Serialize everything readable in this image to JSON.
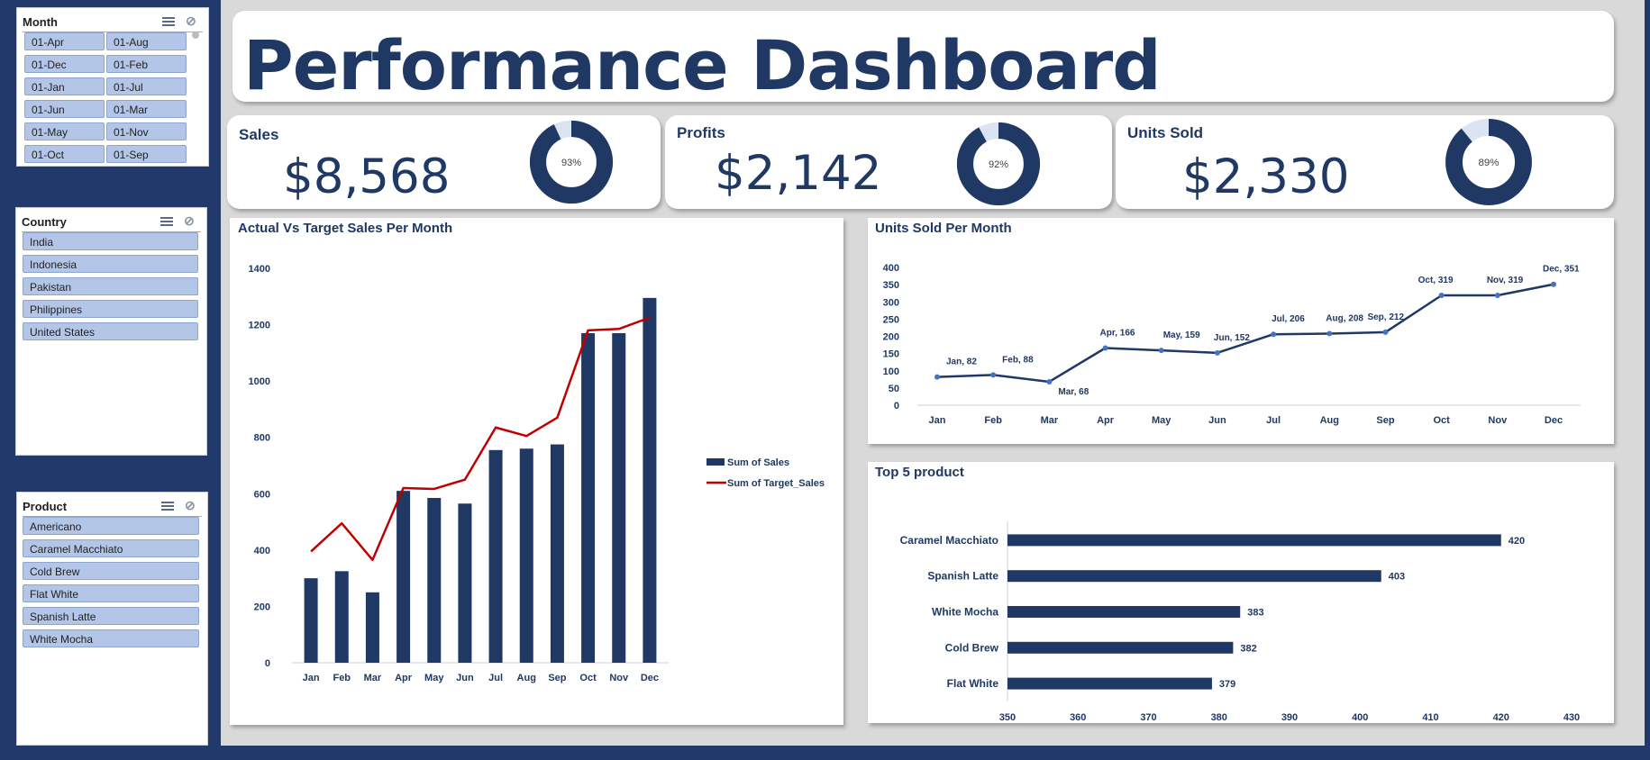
{
  "colors": {
    "navy": "#213a6b",
    "dark_blue": "#1f3864",
    "chip": "#b4c6e7",
    "target_line": "#c00000",
    "donut_track": "#dbe4f3",
    "marker": "#4472c4"
  },
  "slicers": {
    "month": {
      "title": "Month",
      "items": [
        "01-Apr",
        "01-Aug",
        "01-Dec",
        "01-Feb",
        "01-Jan",
        "01-Jul",
        "01-Jun",
        "01-Mar",
        "01-May",
        "01-Nov",
        "01-Oct",
        "01-Sep"
      ]
    },
    "country": {
      "title": "Country",
      "items": [
        "India",
        "Indonesia",
        "Pakistan",
        "Philippines",
        "United States"
      ]
    },
    "product": {
      "title": "Product",
      "items": [
        "Americano",
        "Caramel Macchiato",
        "Cold Brew",
        "Flat White",
        "Spanish Latte",
        "White Mocha"
      ]
    }
  },
  "dashboard": {
    "title": "Performance Dashboard"
  },
  "kpis": [
    {
      "label": "Sales",
      "value": "$8,568",
      "percent": 93,
      "percent_label": "93%"
    },
    {
      "label": "Profits",
      "value": "$2,142",
      "percent": 92,
      "percent_label": "92%"
    },
    {
      "label": "Units Sold",
      "value": "$2,330",
      "percent": 89,
      "percent_label": "89%"
    }
  ],
  "panels": {
    "actual_vs_target": "Actual Vs Target Sales Per Month",
    "units_sold": "Units Sold Per Month",
    "top_products": "Top 5 product"
  },
  "chart_data": [
    {
      "type": "bar",
      "title": "Actual Vs Target Sales Per Month",
      "categories": [
        "Jan",
        "Feb",
        "Mar",
        "Apr",
        "May",
        "Jun",
        "Jul",
        "Aug",
        "Sep",
        "Oct",
        "Nov",
        "Dec"
      ],
      "series": [
        {
          "name": "Sum of Sales",
          "kind": "bar",
          "values": [
            300,
            325,
            250,
            610,
            585,
            565,
            755,
            760,
            775,
            1170,
            1170,
            1295
          ]
        },
        {
          "name": "Sum of Target_Sales",
          "kind": "line",
          "values": [
            395,
            495,
            365,
            620,
            617,
            650,
            835,
            805,
            870,
            1180,
            1185,
            1225
          ]
        }
      ],
      "ylim": [
        0,
        1400
      ],
      "yticks": [
        0,
        200,
        400,
        600,
        800,
        1000,
        1200,
        1400
      ],
      "legend": "right"
    },
    {
      "type": "line",
      "title": "Units Sold Per Month",
      "categories": [
        "Jan",
        "Feb",
        "Mar",
        "Apr",
        "May",
        "Jun",
        "Jul",
        "Aug",
        "Sep",
        "Oct",
        "Nov",
        "Dec"
      ],
      "values": [
        82,
        88,
        68,
        166,
        159,
        152,
        206,
        208,
        212,
        319,
        319,
        351
      ],
      "data_labels": [
        "Jan, 82",
        "Feb, 88",
        "Mar, 68",
        "Apr, 166",
        "May, 159",
        "Jun, 152",
        "Jul, 206",
        "Aug, 208",
        "Sep, 212",
        "Oct, 319",
        "Nov, 319",
        "Dec, 351"
      ],
      "ylim": [
        0,
        400
      ],
      "yticks": [
        0,
        50,
        100,
        150,
        200,
        250,
        300,
        350,
        400
      ]
    },
    {
      "type": "bar",
      "orientation": "horizontal",
      "title": "Top 5 product",
      "categories": [
        "Caramel Macchiato",
        "Spanish Latte",
        "White Mocha",
        "Cold Brew",
        "Flat White"
      ],
      "values": [
        420,
        403,
        383,
        382,
        379
      ],
      "xlim": [
        350,
        430
      ],
      "xticks": [
        350,
        360,
        370,
        380,
        390,
        400,
        410,
        420,
        430
      ]
    }
  ]
}
